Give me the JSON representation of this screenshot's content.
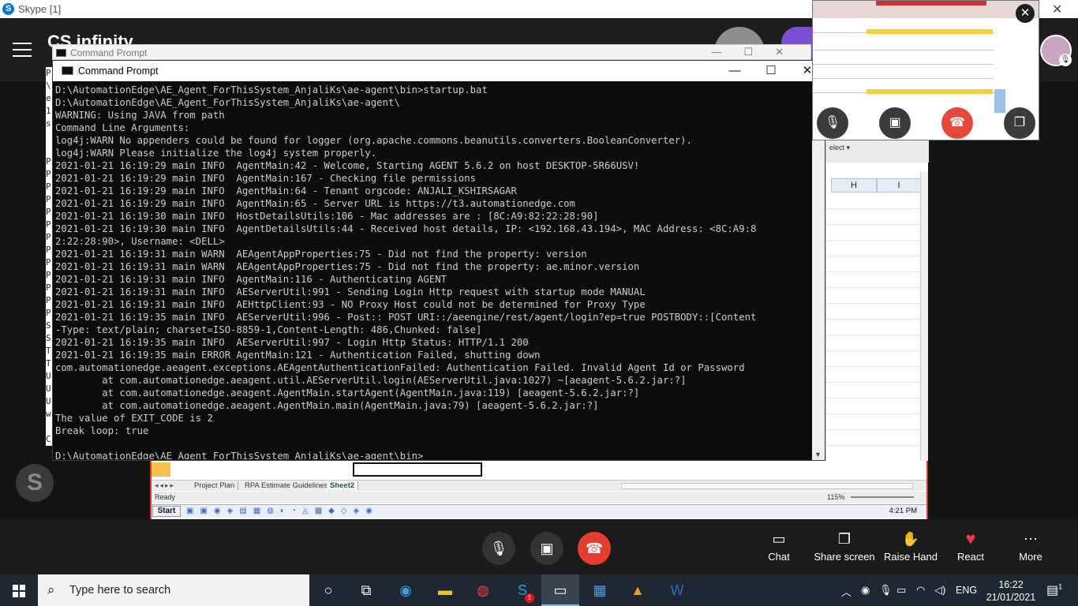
{
  "skype": {
    "window_title": "Skype [1]",
    "brand_partial": "CS infinity",
    "left_strip_letters": "P\n\\\ne\n1\ns\n \n \nP\nP\nP\nP\nP\nP\nP\nP\nP\nP\nP\nP\nP\nS\nS\nT\nT\nU\nU\nU\nw\n \nC"
  },
  "cmd_back": {
    "title": "Command Prompt"
  },
  "cmd": {
    "title": "Command Prompt",
    "minimize": "—",
    "maximize": "☐",
    "close": "✕",
    "lines": [
      "D:\\AutomationEdge\\AE_Agent_ForThisSystem_AnjaliKs\\ae-agent\\bin>startup.bat",
      "D:\\AutomationEdge\\AE_Agent_ForThisSystem_AnjaliKs\\ae-agent\\",
      "WARNING: Using JAVA from path",
      "Command Line Arguments:",
      "log4j:WARN No appenders could be found for logger (org.apache.commons.beanutils.converters.BooleanConverter).",
      "log4j:WARN Please initialize the log4j system properly.",
      "2021-01-21 16:19:29 main INFO  AgentMain:42 - Welcome, Starting AGENT 5.6.2 on host DESKTOP-5R66USV!",
      "2021-01-21 16:19:29 main INFO  AgentMain:167 - Checking file permissions",
      "2021-01-21 16:19:29 main INFO  AgentMain:64 - Tenant orgcode: ANJALI_KSHIRSAGAR",
      "2021-01-21 16:19:29 main INFO  AgentMain:65 - Server URL is https://t3.automationedge.com",
      "2021-01-21 16:19:30 main INFO  HostDetailsUtils:106 - Mac addresses are : [8C:A9:82:22:28:90]",
      "2021-01-21 16:19:30 main INFO  AgentDetailsUtils:44 - Received host details, IP: <192.168.43.194>, MAC Address: <8C:A9:8",
      "2:22:28:90>, Username: <DELL>",
      "2021-01-21 16:19:31 main WARN  AEAgentAppProperties:75 - Did not find the property: version",
      "2021-01-21 16:19:31 main WARN  AEAgentAppProperties:75 - Did not find the property: ae.minor.version",
      "2021-01-21 16:19:31 main INFO  AgentMain:116 - Authenticating AGENT",
      "2021-01-21 16:19:31 main INFO  AEServerUtil:991 - Sending Login Http request with startup mode MANUAL",
      "2021-01-21 16:19:31 main INFO  AEHttpClient:93 - NO Proxy Host could not be determined for Proxy Type",
      "2021-01-21 16:19:35 main INFO  AEServerUtil:996 - Post:: POST URI::/aeengine/rest/agent/login?ep=true POSTBODY::[Content",
      "-Type: text/plain; charset=ISO-8859-1,Content-Length: 486,Chunked: false]",
      "2021-01-21 16:19:35 main INFO  AEServerUtil:997 - Login Http Status: HTTP/1.1 200",
      "2021-01-21 16:19:35 main ERROR AgentMain:121 - Authentication Failed, shutting down",
      "com.automationedge.aeagent.exceptions.AEAgentAuthenticationFailed: Authentication Failed. Invalid Agent Id or Password",
      "        at com.automationedge.aeagent.util.AEServerUtil.login(AEServerUtil.java:1027) ~[aeagent-5.6.2.jar:?]",
      "        at com.automationedge.aeagent.AgentMain.startAgent(AgentMain.java:119) [aeagent-5.6.2.jar:?]",
      "        at com.automationedge.aeagent.AgentMain.main(AgentMain.java:79) [aeagent-5.6.2.jar:?]",
      "The value of EXIT_CODE is 2",
      "Break loop: true",
      "",
      "D:\\AutomationEdge\\AE_Agent_ForThisSystem_AnjaliKs\\ae-agent\\bin>"
    ]
  },
  "excel": {
    "namebox": "elect ▾",
    "col_h": "H",
    "col_i": "I",
    "sheet_tabs": [
      "Project Plan",
      "RPA Estimate Guidelines",
      "Sheet2"
    ],
    "active_tab": "Sheet2",
    "status": "Ready",
    "zoom": "115%",
    "start": "Start",
    "clock": "4:21 PM"
  },
  "call_bar": {
    "tools": [
      {
        "label": "Chat",
        "icon": "chat-icon"
      },
      {
        "label": "Share screen",
        "icon": "share-screen-icon"
      },
      {
        "label": "Raise Hand",
        "icon": "raise-hand-icon"
      },
      {
        "label": "React",
        "icon": "heart-icon"
      },
      {
        "label": "More",
        "icon": "more-icon"
      }
    ],
    "end_color": "#e53e30"
  },
  "taskbar": {
    "search_placeholder": "Type here to search",
    "language": "ENG",
    "time": "16:22",
    "date": "21/01/2021",
    "skype_badge": "1",
    "notification_badge": "1"
  }
}
